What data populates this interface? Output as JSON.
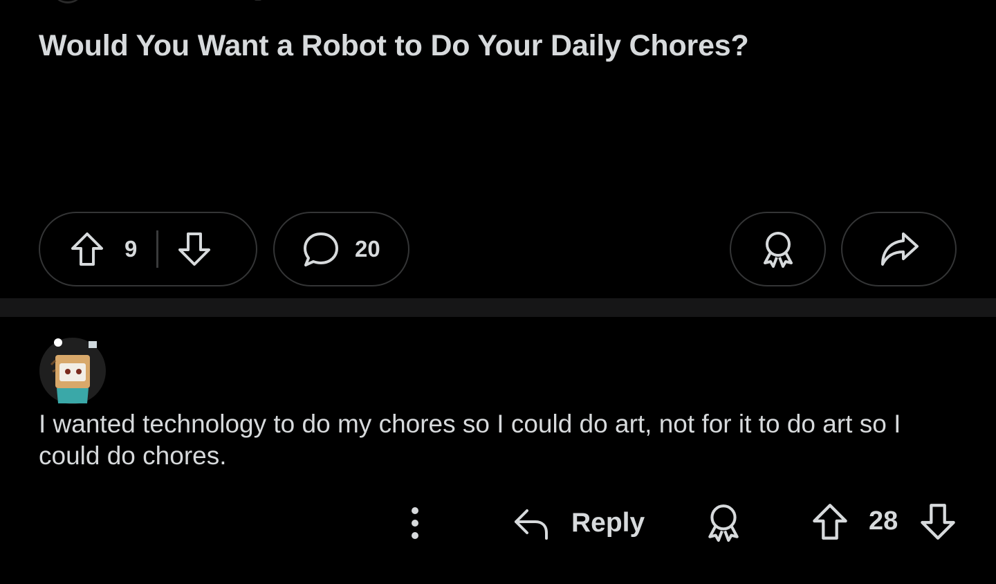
{
  "post": {
    "title": "Would You Want a Robot to Do Your Daily Chores?",
    "upvote_count": "9",
    "comment_count": "20"
  },
  "comment": {
    "body": "I wanted technology to do my chores so I could do art, not for it to do art so I could do chores.",
    "reply_label": "Reply",
    "vote_count": "28"
  },
  "colors": {
    "background": "#000000",
    "text": "#d7dadc",
    "pill_border": "#343536",
    "separator": "#161617"
  },
  "icons": {
    "upvote": "arrow-up-icon",
    "downvote": "arrow-down-icon",
    "comment": "speech-bubble-icon",
    "award": "award-ribbon-icon",
    "share": "share-arrow-icon",
    "more": "vertical-dots-icon",
    "reply": "reply-arrow-icon"
  }
}
